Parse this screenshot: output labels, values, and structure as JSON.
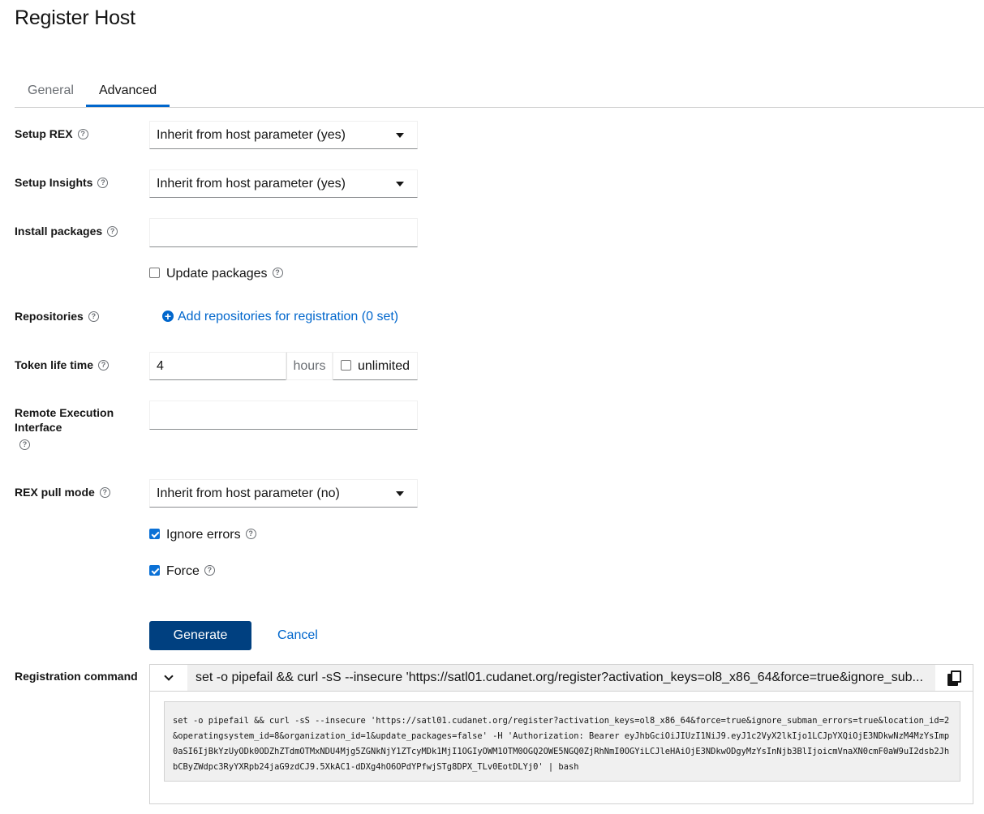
{
  "page": {
    "title": "Register Host"
  },
  "tabs": {
    "general": "General",
    "advanced": "Advanced"
  },
  "form": {
    "setup_rex": {
      "label": "Setup REX",
      "value": "Inherit from host parameter (yes)"
    },
    "setup_insights": {
      "label": "Setup Insights",
      "value": "Inherit from host parameter (yes)"
    },
    "install_packages": {
      "label": "Install packages",
      "value": ""
    },
    "update_packages": {
      "label": "Update packages",
      "checked": false
    },
    "repositories": {
      "label": "Repositories",
      "link": "Add repositories for registration (0 set)"
    },
    "token_life_time": {
      "label": "Token life time",
      "value": "4",
      "unit": "hours",
      "unlimited_label": "unlimited",
      "unlimited_checked": false
    },
    "remote_execution_interface": {
      "label_line1": "Remote Execution",
      "label_line2": "Interface",
      "value": ""
    },
    "rex_pull_mode": {
      "label": "REX pull mode",
      "value": "Inherit from host parameter (no)"
    },
    "ignore_errors": {
      "label": "Ignore errors",
      "checked": true
    },
    "force": {
      "label": "Force",
      "checked": true
    }
  },
  "actions": {
    "generate": "Generate",
    "cancel": "Cancel"
  },
  "registration": {
    "label": "Registration command",
    "summary": "set -o pipefail && curl -sS --insecure 'https://satl01.cudanet.org/register?activation_keys=ol8_x86_64&force=true&ignore_sub...",
    "command": "set -o pipefail && curl -sS --insecure 'https://satl01.cudanet.org/register?activation_keys=ol8_x86_64&force=true&ignore_subman_errors=true&location_id=2&operatingsystem_id=8&organization_id=1&update_packages=false' -H 'Authorization: Bearer eyJhbGciOiJIUzI1NiJ9.eyJ1c2VyX2lkIjo1LCJpYXQiOjE3NDkwNzM4MzYsImp0aSI6IjBkYzUyODk0ODZhZTdmOTMxNDU4Mjg5ZGNkNjY1ZTcyMDk1MjI1OGIyOWM1OTM0OGQ2OWE5NGQ0ZjRhNmI0OGYiLCJleHAiOjE3NDkwODgyMzYsInNjb3BlIjoicmVnaXN0cmF0aW9uI2dsb2JhbCByZWdpc3RyYXRpb24jaG9zdCJ9.5XkAC1-dDXg4hO6OPdYPfwjSTg8DPX_TLv0EotDLYj0' | bash"
  },
  "icons": [
    "help-icon",
    "caret-down-icon",
    "plus-circle-icon",
    "checkbox-icon",
    "chevron-down-icon",
    "copy-icon"
  ],
  "colors": {
    "primary": "#004080",
    "link": "#0066cc",
    "tab_active": "#0066cc",
    "checkbox": "#0b71d6"
  }
}
